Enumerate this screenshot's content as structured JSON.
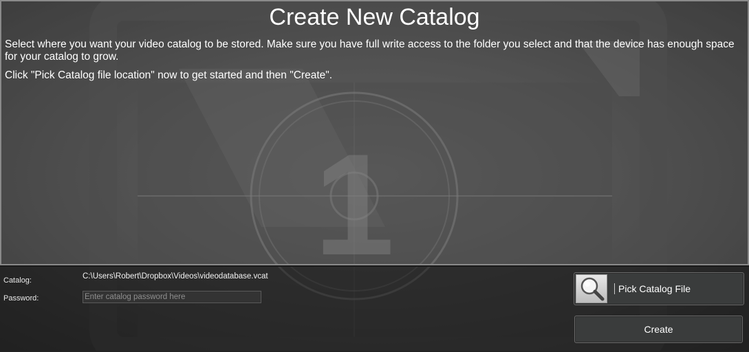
{
  "header": {
    "title": "Create New Catalog",
    "description": "Select where you want your video catalog to be stored. Make sure you have full write access to the folder you select and that the device has enough space for your catalog to grow.",
    "instructions": "Click \"Pick Catalog file location\" now to get started and then \"Create\"."
  },
  "form": {
    "catalog_label": "Catalog:",
    "catalog_path": "C:\\Users\\Robert\\Dropbox\\Videos\\videodatabase.vcat",
    "password_label": "Password:",
    "password_value": "",
    "password_placeholder": "Enter catalog password here"
  },
  "actions": {
    "pick_label": "Pick Catalog File",
    "pick_icon": "magnifier-icon",
    "create_label": "Create"
  },
  "background": {
    "countdown_digit": "1"
  },
  "colors": {
    "panel_border": "#8a8a8a",
    "text": "#ffffff",
    "button_bg": "#3a3c3c"
  }
}
